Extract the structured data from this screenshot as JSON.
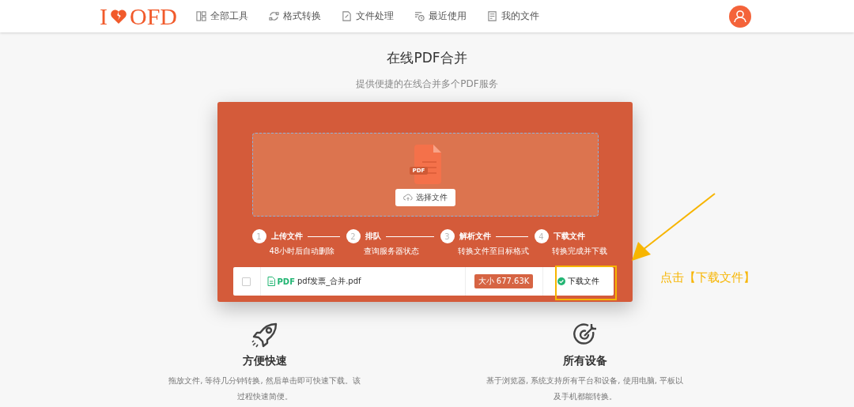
{
  "header": {
    "logo": {
      "left": "I",
      "right": "OFD"
    },
    "nav": [
      {
        "label": "全部工具"
      },
      {
        "label": "格式转换"
      },
      {
        "label": "文件处理"
      },
      {
        "label": "最近使用"
      },
      {
        "label": "我的文件"
      }
    ]
  },
  "title": "在线PDF合并",
  "subtitle": "提供便捷的在线合并多个PDF服务",
  "upload": {
    "file_badge": "PDF",
    "button": "选择文件"
  },
  "steps": [
    {
      "number": "1",
      "title": "上传文件",
      "desc": "48小时后自动删除"
    },
    {
      "number": "2",
      "title": "排队",
      "desc": "查询服务器状态"
    },
    {
      "number": "3",
      "title": "解析文件",
      "desc": "转换文件至目标格式"
    },
    {
      "number": "4",
      "title": "下载文件",
      "desc": "转换完成并下载"
    }
  ],
  "files": [
    {
      "checked": false,
      "type": "PDF",
      "name": "pdf发票_合并.pdf",
      "size": "大小 677.63K",
      "action": "下载文件",
      "done": true
    }
  ],
  "features": [
    {
      "title": "方便快速",
      "desc": "拖放文件, 等待几分钟转换, 然后单击即可快速下载。该过程快速简便。"
    },
    {
      "title": "所有设备",
      "desc": "基于浏览器, 系统支持所有平台和设备, 使用电脑, 平板以及手机都能转换。"
    }
  ],
  "annotation": {
    "text": "点击【下载文件】"
  }
}
